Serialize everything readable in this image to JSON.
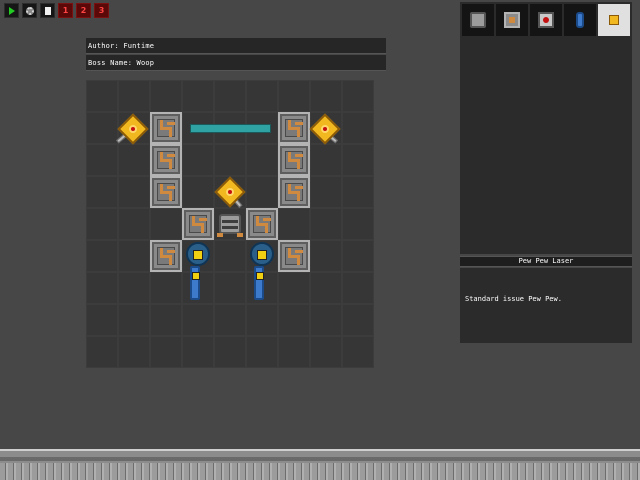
{
  "toolbar": {
    "buttons": [
      {
        "name": "play",
        "label": ""
      },
      {
        "name": "settings",
        "label": ""
      },
      {
        "name": "new",
        "label": ""
      },
      {
        "name": "slot-1",
        "label": "1"
      },
      {
        "name": "slot-2",
        "label": "2"
      },
      {
        "name": "slot-3",
        "label": "3"
      }
    ]
  },
  "info": {
    "author": "Author: Funtime",
    "boss_name": "Boss Name: Woop"
  },
  "palette": {
    "tabs": [
      {
        "icon": "core-icon"
      },
      {
        "icon": "armor-icon"
      },
      {
        "icon": "laser-block-icon"
      },
      {
        "icon": "thruster-icon"
      },
      {
        "icon": "laser-cannon-icon",
        "active": true
      }
    ]
  },
  "selected_part": {
    "title": "Pew Pew Laser",
    "description": "Standard issue Pew Pew."
  },
  "colors": {
    "background": "#474747",
    "grid": "#353535",
    "health": "#2fa3a3",
    "laser": "#f2b820",
    "thruster": "#3d7acc",
    "armor_pipe": "#d08a40"
  }
}
